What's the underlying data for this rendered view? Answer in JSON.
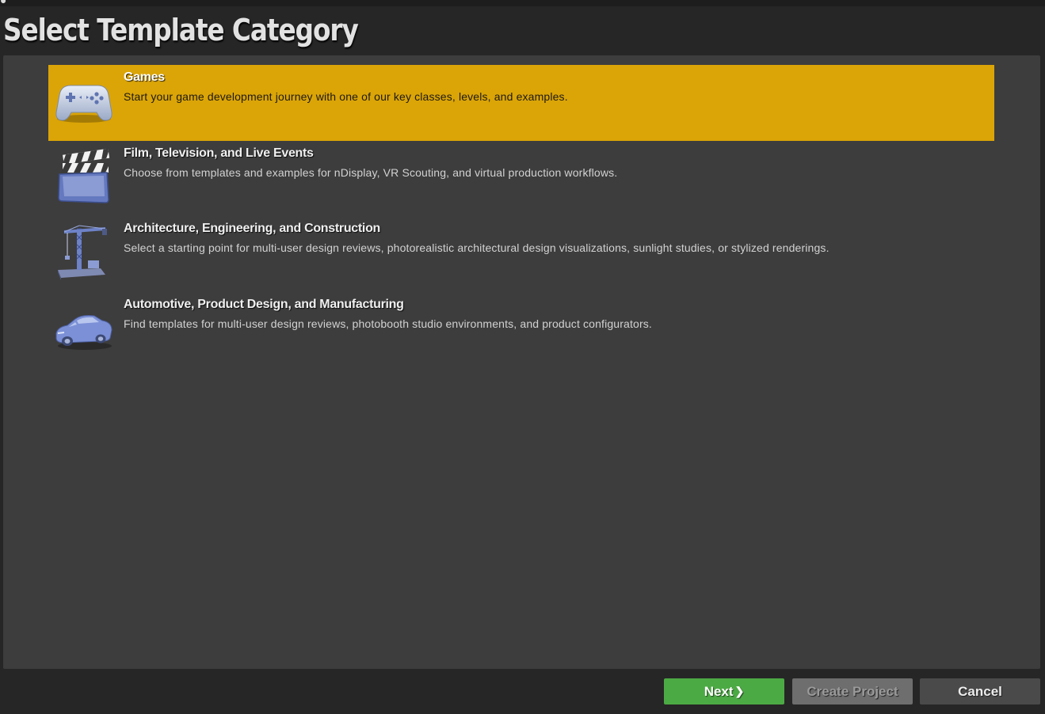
{
  "header": {
    "title": "Select Template Category"
  },
  "categories": [
    {
      "title": "Games",
      "description": "Start your game development journey with one of our key classes, levels, and examples.",
      "icon": "gamepad-icon",
      "selected": true
    },
    {
      "title": "Film, Television, and Live Events",
      "description": "Choose from templates and examples for nDisplay, VR Scouting, and virtual production workflows.",
      "icon": "clapperboard-icon",
      "selected": false
    },
    {
      "title": "Architecture, Engineering, and Construction",
      "description": "Select a starting point for multi-user design reviews, photorealistic architectural design visualizations, sunlight studies, or stylized renderings.",
      "icon": "crane-icon",
      "selected": false
    },
    {
      "title": "Automotive, Product Design, and Manufacturing",
      "description": "Find templates for multi-user design reviews, photobooth studio environments, and product configurators.",
      "icon": "car-icon",
      "selected": false
    }
  ],
  "footer": {
    "next_label": "Next",
    "next_icon": "chevron-right-icon",
    "create_label": "Create Project",
    "create_enabled": false,
    "cancel_label": "Cancel"
  },
  "colors": {
    "selected_highlight": "#dba507",
    "next_button": "#4caa44",
    "panel_background": "#3d3d3d",
    "window_background": "#262626"
  }
}
